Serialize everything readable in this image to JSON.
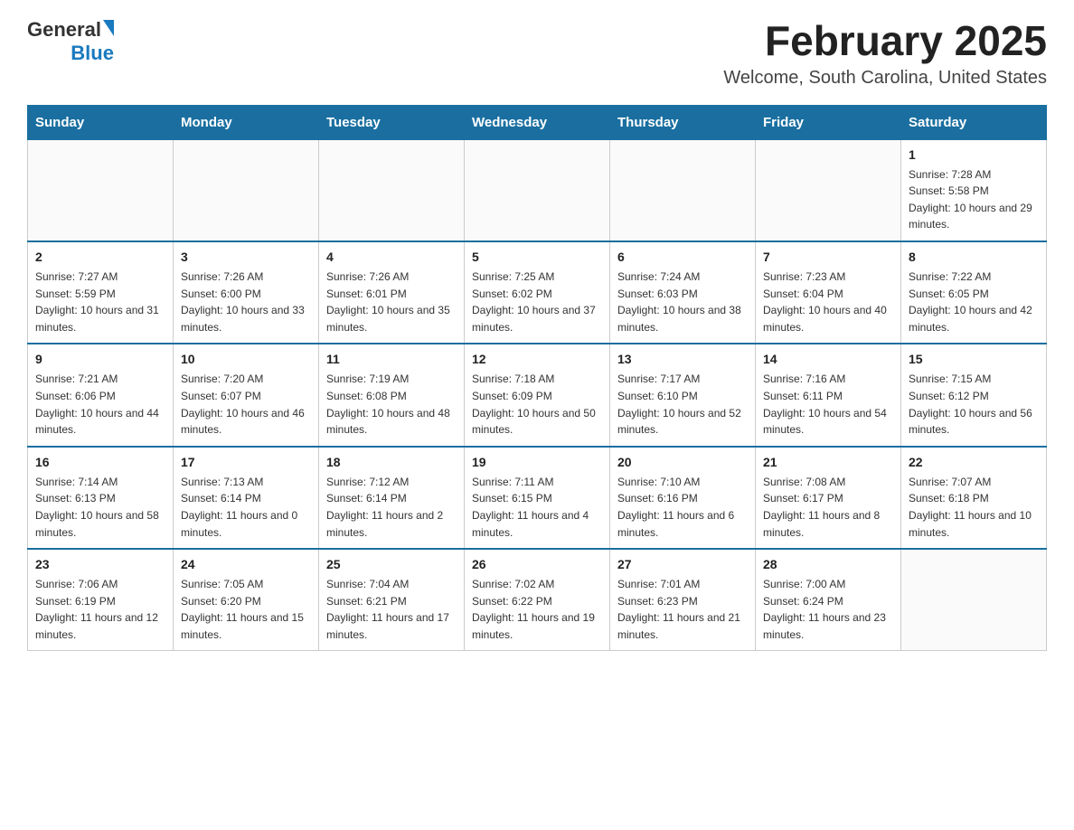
{
  "logo": {
    "text_general": "General",
    "text_blue": "Blue"
  },
  "header": {
    "title": "February 2025",
    "subtitle": "Welcome, South Carolina, United States"
  },
  "calendar": {
    "days_of_week": [
      "Sunday",
      "Monday",
      "Tuesday",
      "Wednesday",
      "Thursday",
      "Friday",
      "Saturday"
    ],
    "weeks": [
      [
        {
          "day": "",
          "info": ""
        },
        {
          "day": "",
          "info": ""
        },
        {
          "day": "",
          "info": ""
        },
        {
          "day": "",
          "info": ""
        },
        {
          "day": "",
          "info": ""
        },
        {
          "day": "",
          "info": ""
        },
        {
          "day": "1",
          "info": "Sunrise: 7:28 AM\nSunset: 5:58 PM\nDaylight: 10 hours and 29 minutes."
        }
      ],
      [
        {
          "day": "2",
          "info": "Sunrise: 7:27 AM\nSunset: 5:59 PM\nDaylight: 10 hours and 31 minutes."
        },
        {
          "day": "3",
          "info": "Sunrise: 7:26 AM\nSunset: 6:00 PM\nDaylight: 10 hours and 33 minutes."
        },
        {
          "day": "4",
          "info": "Sunrise: 7:26 AM\nSunset: 6:01 PM\nDaylight: 10 hours and 35 minutes."
        },
        {
          "day": "5",
          "info": "Sunrise: 7:25 AM\nSunset: 6:02 PM\nDaylight: 10 hours and 37 minutes."
        },
        {
          "day": "6",
          "info": "Sunrise: 7:24 AM\nSunset: 6:03 PM\nDaylight: 10 hours and 38 minutes."
        },
        {
          "day": "7",
          "info": "Sunrise: 7:23 AM\nSunset: 6:04 PM\nDaylight: 10 hours and 40 minutes."
        },
        {
          "day": "8",
          "info": "Sunrise: 7:22 AM\nSunset: 6:05 PM\nDaylight: 10 hours and 42 minutes."
        }
      ],
      [
        {
          "day": "9",
          "info": "Sunrise: 7:21 AM\nSunset: 6:06 PM\nDaylight: 10 hours and 44 minutes."
        },
        {
          "day": "10",
          "info": "Sunrise: 7:20 AM\nSunset: 6:07 PM\nDaylight: 10 hours and 46 minutes."
        },
        {
          "day": "11",
          "info": "Sunrise: 7:19 AM\nSunset: 6:08 PM\nDaylight: 10 hours and 48 minutes."
        },
        {
          "day": "12",
          "info": "Sunrise: 7:18 AM\nSunset: 6:09 PM\nDaylight: 10 hours and 50 minutes."
        },
        {
          "day": "13",
          "info": "Sunrise: 7:17 AM\nSunset: 6:10 PM\nDaylight: 10 hours and 52 minutes."
        },
        {
          "day": "14",
          "info": "Sunrise: 7:16 AM\nSunset: 6:11 PM\nDaylight: 10 hours and 54 minutes."
        },
        {
          "day": "15",
          "info": "Sunrise: 7:15 AM\nSunset: 6:12 PM\nDaylight: 10 hours and 56 minutes."
        }
      ],
      [
        {
          "day": "16",
          "info": "Sunrise: 7:14 AM\nSunset: 6:13 PM\nDaylight: 10 hours and 58 minutes."
        },
        {
          "day": "17",
          "info": "Sunrise: 7:13 AM\nSunset: 6:14 PM\nDaylight: 11 hours and 0 minutes."
        },
        {
          "day": "18",
          "info": "Sunrise: 7:12 AM\nSunset: 6:14 PM\nDaylight: 11 hours and 2 minutes."
        },
        {
          "day": "19",
          "info": "Sunrise: 7:11 AM\nSunset: 6:15 PM\nDaylight: 11 hours and 4 minutes."
        },
        {
          "day": "20",
          "info": "Sunrise: 7:10 AM\nSunset: 6:16 PM\nDaylight: 11 hours and 6 minutes."
        },
        {
          "day": "21",
          "info": "Sunrise: 7:08 AM\nSunset: 6:17 PM\nDaylight: 11 hours and 8 minutes."
        },
        {
          "day": "22",
          "info": "Sunrise: 7:07 AM\nSunset: 6:18 PM\nDaylight: 11 hours and 10 minutes."
        }
      ],
      [
        {
          "day": "23",
          "info": "Sunrise: 7:06 AM\nSunset: 6:19 PM\nDaylight: 11 hours and 12 minutes."
        },
        {
          "day": "24",
          "info": "Sunrise: 7:05 AM\nSunset: 6:20 PM\nDaylight: 11 hours and 15 minutes."
        },
        {
          "day": "25",
          "info": "Sunrise: 7:04 AM\nSunset: 6:21 PM\nDaylight: 11 hours and 17 minutes."
        },
        {
          "day": "26",
          "info": "Sunrise: 7:02 AM\nSunset: 6:22 PM\nDaylight: 11 hours and 19 minutes."
        },
        {
          "day": "27",
          "info": "Sunrise: 7:01 AM\nSunset: 6:23 PM\nDaylight: 11 hours and 21 minutes."
        },
        {
          "day": "28",
          "info": "Sunrise: 7:00 AM\nSunset: 6:24 PM\nDaylight: 11 hours and 23 minutes."
        },
        {
          "day": "",
          "info": ""
        }
      ]
    ]
  }
}
